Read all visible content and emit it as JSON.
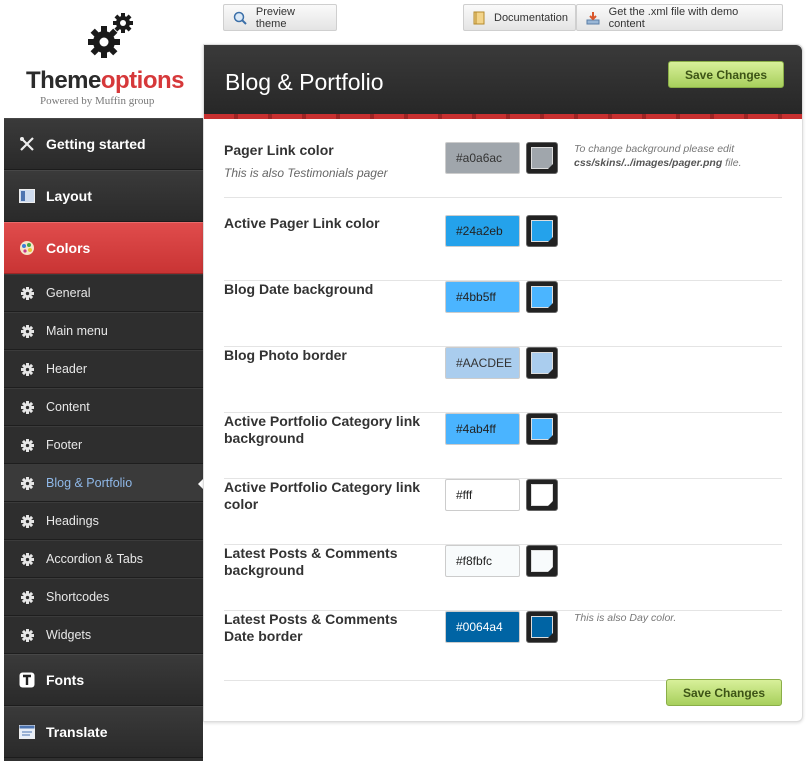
{
  "logo": {
    "brand_a": "Theme",
    "brand_b": "options",
    "powered": "Powered by Muffin group"
  },
  "toolbar": {
    "preview": "Preview theme",
    "docs": "Documentation",
    "xml": "Get the .xml file with demo content"
  },
  "sidebar": {
    "main_top": [
      {
        "label": "Getting started",
        "icon": "tools-icon"
      },
      {
        "label": "Layout",
        "icon": "layout-icon"
      },
      {
        "label": "Colors",
        "icon": "palette-icon"
      }
    ],
    "sub": [
      {
        "label": "General"
      },
      {
        "label": "Main menu"
      },
      {
        "label": "Header"
      },
      {
        "label": "Content"
      },
      {
        "label": "Footer"
      },
      {
        "label": "Blog & Portfolio"
      },
      {
        "label": "Headings"
      },
      {
        "label": "Accordion & Tabs"
      },
      {
        "label": "Shortcodes"
      },
      {
        "label": "Widgets"
      }
    ],
    "main_bottom": [
      {
        "label": "Fonts",
        "icon": "font-icon"
      },
      {
        "label": "Translate",
        "icon": "translate-icon"
      }
    ]
  },
  "panel": {
    "title": "Blog & Portfolio",
    "save_label": "Save Changes",
    "rows": [
      {
        "label": "Pager Link color",
        "sub": "This is also Testimonials pager",
        "value": "#a0a6ac",
        "color": "#a0a6ac",
        "text_color": "#333333",
        "hint_a": "To change background please edit",
        "hint_b": "css/skins/../images/pager.png",
        "hint_c": " file."
      },
      {
        "label": "Active Pager Link color",
        "value": "#24a2eb",
        "color": "#24a2eb",
        "text_color": "#222222"
      },
      {
        "label": "Blog Date background",
        "value": "#4bb5ff",
        "color": "#4bb5ff",
        "text_color": "#222222"
      },
      {
        "label": "Blog Photo border",
        "value": "#AACDEE",
        "color": "#AACDEE",
        "text_color": "#333333"
      },
      {
        "label": "Active Portfolio Category link background",
        "value": "#4ab4ff",
        "color": "#4ab4ff",
        "text_color": "#222222"
      },
      {
        "label": "Active Portfolio Category link color",
        "value": "#fff",
        "color": "#ffffff",
        "text_color": "#222222"
      },
      {
        "label": "Latest Posts & Comments background",
        "value": "#f8fbfc",
        "color": "#f8fbfc",
        "text_color": "#222222"
      },
      {
        "label": "Latest Posts & Comments Date border",
        "value": "#0064a4",
        "color": "#0064a4",
        "text_color": "#ffffff",
        "hint_a": "This is also Day color."
      }
    ]
  }
}
